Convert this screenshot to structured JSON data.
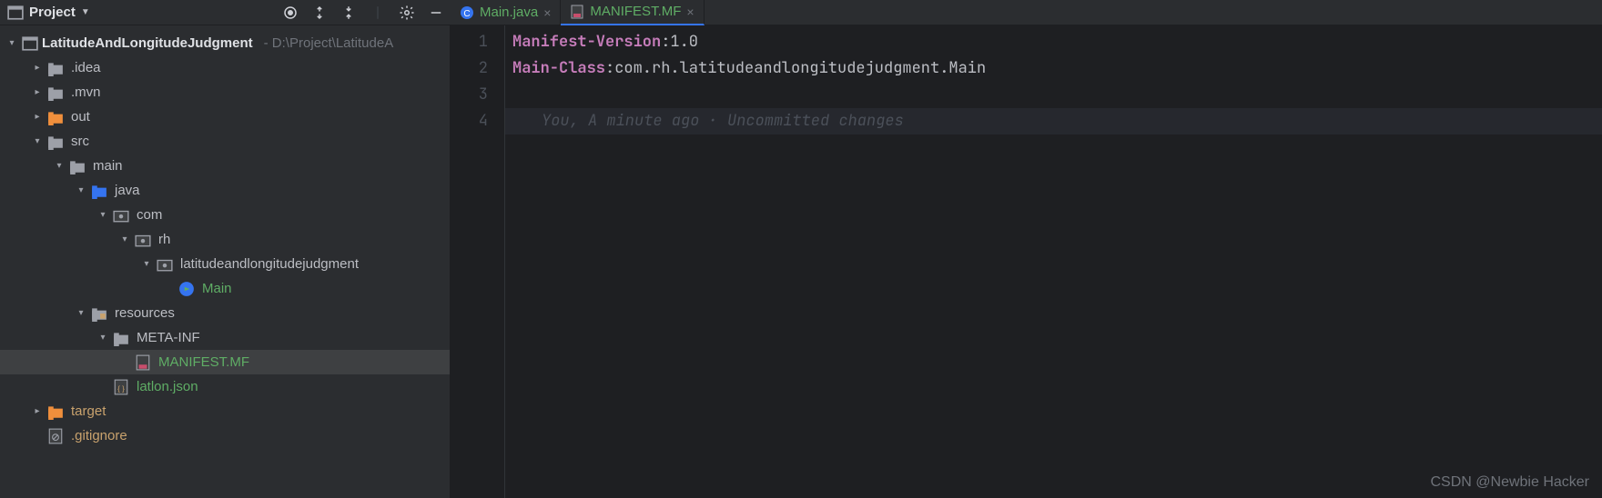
{
  "toolwindow": {
    "title": "Project"
  },
  "tabs": [
    {
      "label": "Main.java",
      "type": "java",
      "active": false
    },
    {
      "label": "MANIFEST.MF",
      "type": "mf",
      "active": true
    }
  ],
  "project": {
    "root": {
      "name": "LatitudeAndLongitudeJudgment",
      "path": "- D:\\Project\\LatitudeA"
    },
    "nodes": {
      "idea": ".idea",
      "mvn": ".mvn",
      "out": "out",
      "src": "src",
      "main": "main",
      "java": "java",
      "com": "com",
      "rh": "rh",
      "pkg": "latitudeandlongitudejudgment",
      "mainClass": "Main",
      "resources": "resources",
      "metaInf": "META-INF",
      "manifest": "MANIFEST.MF",
      "latlon": "latlon.json",
      "target": "target",
      "gitignore": ".gitignore"
    }
  },
  "editor": {
    "gutterLines": [
      "1",
      "2",
      "3",
      "4"
    ],
    "line1": {
      "key": "Manifest-Version",
      "colon": ": ",
      "value": "1.0"
    },
    "line2": {
      "key": "Main-Class",
      "colon": ": ",
      "value": "com.rh.latitudeandlongitudejudgment.Main"
    },
    "blame": "You, A minute ago · Uncommitted changes"
  },
  "watermark": "CSDN @Newbie Hacker"
}
